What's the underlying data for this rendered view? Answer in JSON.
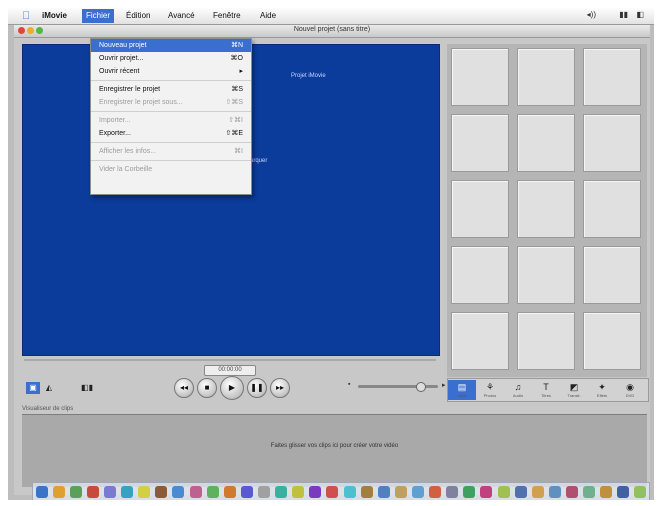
{
  "menubar": {
    "apple": "",
    "items": [
      {
        "label": "iMovie"
      },
      {
        "label": "Fichier",
        "active": true
      },
      {
        "label": "Édition"
      },
      {
        "label": "Avancé"
      },
      {
        "label": "Fenêtre"
      },
      {
        "label": "Aide"
      }
    ],
    "clock": "",
    "icons": [
      "volume-icon",
      "sound-icon"
    ]
  },
  "window": {
    "title": "Nouvel projet (sans titre)"
  },
  "monitor": {
    "overlay_text_1": "Projet iMovie",
    "overlay_text_2": "Marquer"
  },
  "file_menu": {
    "items": [
      {
        "label": "Nouveau projet",
        "shortcut": "⌘N",
        "highlighted": true
      },
      {
        "label": "Ouvrir projet...",
        "shortcut": "⌘O"
      },
      {
        "label": "Ouvrir récent",
        "shortcut": "▸"
      },
      {
        "sep": true
      },
      {
        "label": "Enregistrer le projet",
        "shortcut": "⌘S"
      },
      {
        "label": "Enregistrer le projet sous...",
        "shortcut": "⇧⌘S",
        "disabled": true
      },
      {
        "sep": true
      },
      {
        "label": "Importer...",
        "shortcut": "⇧⌘I",
        "disabled": true
      },
      {
        "label": "Exporter...",
        "shortcut": "⇧⌘E"
      },
      {
        "sep": true
      },
      {
        "label": "Afficher les infos...",
        "shortcut": "⌘I",
        "disabled": true
      },
      {
        "sep": true
      },
      {
        "label": "Vider la Corbeille",
        "shortcut": "",
        "disabled": true
      }
    ]
  },
  "transport": {
    "playhead_label": "00:00:00",
    "buttons": [
      "rewind-icon",
      "stop-icon",
      "play-icon",
      "pause-icon",
      "fast-forward-icon"
    ]
  },
  "panes": [
    {
      "label": "Clips",
      "icon": "clips-icon"
    },
    {
      "label": "Photos",
      "icon": "photos-icon"
    },
    {
      "label": "Audio",
      "icon": "audio-icon"
    },
    {
      "label": "Titres",
      "icon": "titles-icon"
    },
    {
      "label": "Transit.",
      "icon": "transitions-icon"
    },
    {
      "label": "Effets",
      "icon": "effects-icon"
    },
    {
      "label": "DVD",
      "icon": "idvd-icon"
    }
  ],
  "clip_viewer": {
    "label": "Visualiseur de clips",
    "hint": "Faites glisser vos clips ici pour créer votre vidéo"
  },
  "dock": {
    "colors": [
      "#3a73c8",
      "#e0a030",
      "#5aa05a",
      "#c84a3a",
      "#7a7ad0",
      "#3aa0c0",
      "#d0d040",
      "#8a5a3a",
      "#4a8ad0",
      "#c06090",
      "#60b060",
      "#d07a30",
      "#5a5ad0",
      "#a0a0a0",
      "#3ab0a0",
      "#c0c040",
      "#7a3ac0",
      "#d05050",
      "#4ac0d0",
      "#a08040",
      "#5080c0",
      "#c0a060",
      "#60a0d0",
      "#d06040",
      "#8080a0",
      "#40a060",
      "#c04080",
      "#a0c050",
      "#5070b0",
      "#d0a050",
      "#6090c0",
      "#b05070",
      "#70b090",
      "#c09040",
      "#4060a0",
      "#90c060"
    ]
  }
}
